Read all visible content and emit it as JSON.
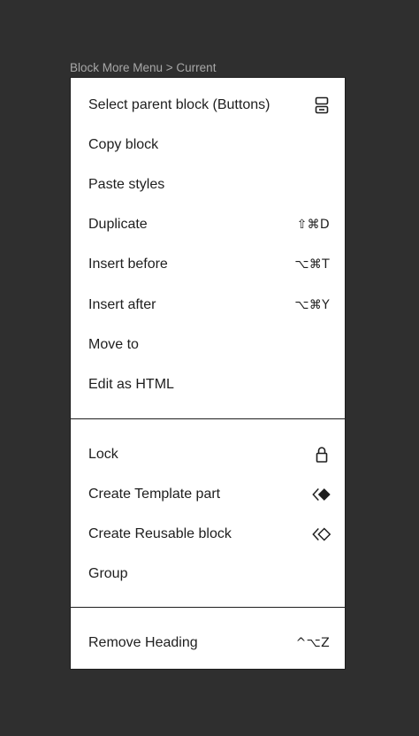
{
  "frame_label": "Block More Menu > Current",
  "menu": {
    "group1": [
      {
        "label": "Select parent block (Buttons)",
        "icon": "parent-block-icon"
      },
      {
        "label": "Copy block"
      },
      {
        "label": "Paste styles"
      },
      {
        "label": "Duplicate",
        "shortcut": "⇧⌘D"
      },
      {
        "label": "Insert before",
        "shortcut": "⌥⌘T"
      },
      {
        "label": "Insert after",
        "shortcut": "⌥⌘Y"
      },
      {
        "label": "Move to"
      },
      {
        "label": "Edit as HTML"
      }
    ],
    "group2": [
      {
        "label": "Lock",
        "icon": "lock-icon"
      },
      {
        "label": "Create Template part",
        "icon": "template-part-icon"
      },
      {
        "label": "Create Reusable block",
        "icon": "reusable-block-icon"
      },
      {
        "label": "Group"
      }
    ],
    "group3": [
      {
        "label": "Remove Heading",
        "shortcut": "^⌥Z"
      }
    ]
  }
}
